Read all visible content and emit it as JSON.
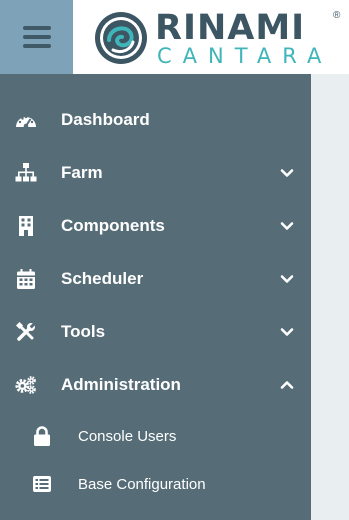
{
  "brand": {
    "name_top": "RINAMI",
    "name_bottom": "CANTARA",
    "registered_mark": "®",
    "colors": {
      "dark": "#3c5663",
      "accent": "#3fb5b9"
    }
  },
  "header": {
    "menu_icon": "hamburger-icon",
    "menu_color": "#7ea2b8"
  },
  "sidebar": {
    "background": "#566d77",
    "items": [
      {
        "label": "Dashboard",
        "icon": "speedometer-icon",
        "has_chevron": false
      },
      {
        "label": "Farm",
        "icon": "sitemap-icon",
        "has_chevron": true,
        "expanded": false
      },
      {
        "label": "Components",
        "icon": "building-icon",
        "has_chevron": true,
        "expanded": false
      },
      {
        "label": "Scheduler",
        "icon": "calendar-icon",
        "has_chevron": true,
        "expanded": false
      },
      {
        "label": "Tools",
        "icon": "tools-icon",
        "has_chevron": true,
        "expanded": false
      },
      {
        "label": "Administration",
        "icon": "gears-icon",
        "has_chevron": true,
        "expanded": true
      }
    ],
    "sub_items": [
      {
        "label": "Console Users",
        "icon": "lock-icon"
      },
      {
        "label": "Base Configuration",
        "icon": "list-icon"
      }
    ]
  }
}
